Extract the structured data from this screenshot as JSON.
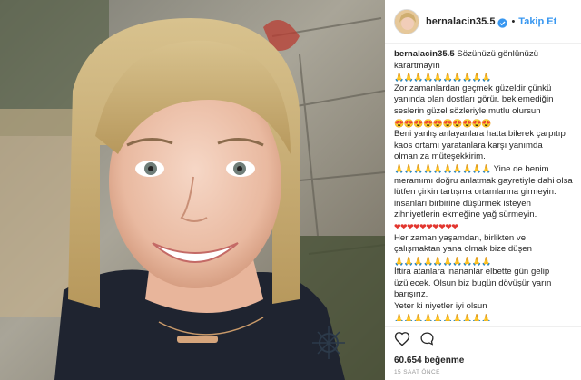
{
  "post": {
    "photo_alt_name": "selfie-photo"
  },
  "header": {
    "username": "bernalacin35.5",
    "separator": "•",
    "follow_label": "Takip Et"
  },
  "caption": {
    "username": "bernalacin35.5",
    "line1": "Sözünüzü gönlünüzü karartmayın",
    "hands1": "🙏🙏🙏🙏🙏🙏🙏🙏🙏🙏",
    "para1": "Zor zamanlardan geçmek güzeldir çünkü yanında olan dostları görür. beklemediğin seslerin güzel sözleriyle mutlu olursun",
    "faces1": "😍😍😍😍😍😍😍😍😍😍",
    "para2": "Beni yanlış anlayanlara hatta bilerek çarpıtıp kaos ortamı yaratanlara karşı yanımda olmanıza müteşekkirim.",
    "hands2": "🙏🙏🙏🙏🙏🙏🙏🙏🙏🙏",
    "para3": "Yine de benim meramımı doğru anlatmak gayretiyle dahi olsa lütfen çirkin tartışma ortamlarına girmeyin. insanları birbirine düşürmek isteyen zihniyetlerin ekmeğine yağ sürmeyin.",
    "hearts": "❤❤❤❤❤❤❤❤❤❤",
    "para4": "Her zaman yaşamdan, birlikten ve çalışmaktan yana olmak bize düşen",
    "hands3": "🙏🙏🙏🙏🙏🙏🙏🙏🙏🙏",
    "para5": "İftira atanlara inananlar elbette gün gelip üzülecek. Olsun biz bugün dövüşür yarın barışırız.",
    "para6": "Yeter ki niyetler iyi olsun",
    "hands4": "🙏🙏🙏🙏🙏🙏🙏🙏🙏🙏"
  },
  "actions": {
    "likes": "60.654 beğenme",
    "timestamp": "15 SAAT ÖNCE"
  },
  "icons": {
    "heart": "heart-icon",
    "comment": "comment-icon",
    "verified": "verified-badge-icon"
  },
  "colors": {
    "follow_blue": "#3897f0",
    "verified_blue": "#3897f0",
    "text": "#262626",
    "muted": "#999999"
  }
}
